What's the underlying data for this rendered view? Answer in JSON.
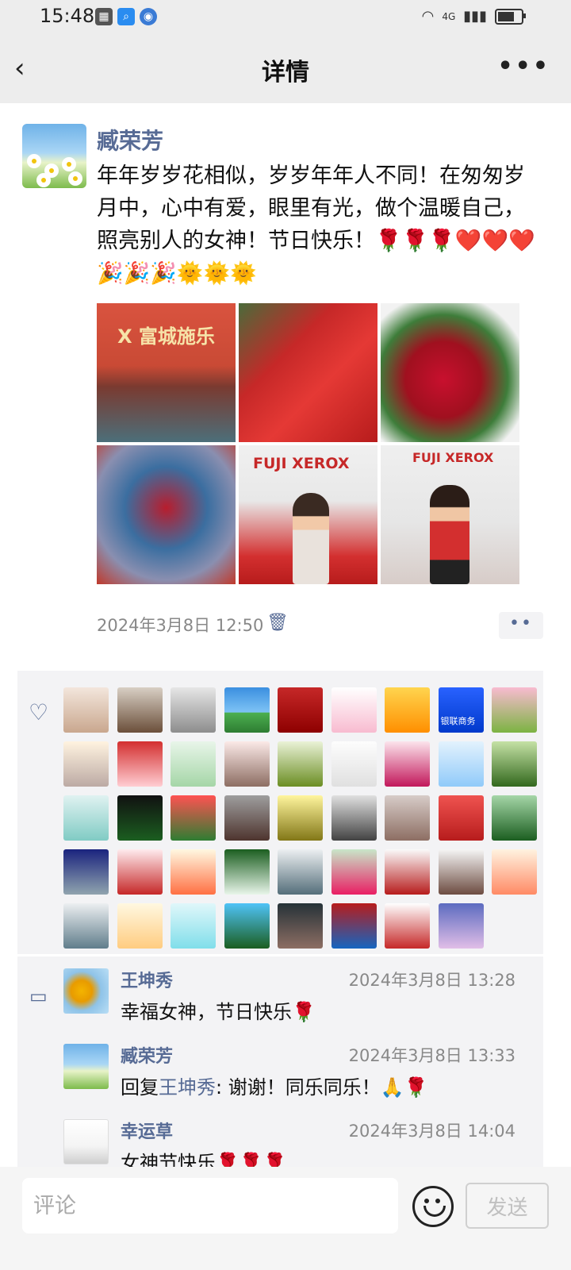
{
  "status_bar": {
    "time": "15:48",
    "network": "4G",
    "battery_level": 0.7
  },
  "nav": {
    "title": "详情",
    "back_glyph": "‹",
    "more_glyph": "•••"
  },
  "post": {
    "author": "臧荣芳",
    "text": "年年岁岁花相似，岁岁年年人不同！在匆匆岁月中，心中有爱，眼里有光，做个温暖自己，照亮别人的女神！节日快乐！🌹🌹🌹❤️❤️❤️🎉🎉🎉🌞🌞🌞",
    "timestamp": "2024年3月8日 12:50",
    "photo_texts": {
      "p1": "X 富城施乐",
      "p5": "FUJI XEROX",
      "p6": "FUJI XEROX"
    },
    "ops_glyph": "••"
  },
  "likes": {
    "count": 44,
    "badges": {
      "card_title": "银联商务"
    }
  },
  "comments": [
    {
      "name": "王坤秀",
      "time": "2024年3月8日 13:28",
      "text": "幸福女神，节日快乐🌹"
    },
    {
      "name": "臧荣芳",
      "time": "2024年3月8日 13:33",
      "reply_prefix": "回复",
      "reply_to": "王坤秀",
      "text": ": 谢谢！同乐同乐！🙏🌹"
    },
    {
      "name": "幸运草",
      "time": "2024年3月8日 14:04",
      "text": "女神节快乐🌹🌹🌹"
    }
  ],
  "input": {
    "placeholder": "评论",
    "send_label": "发送"
  },
  "colors": {
    "link": "#576b95",
    "bar_bg": "#ededed",
    "panel_bg": "#f3f3f5"
  }
}
